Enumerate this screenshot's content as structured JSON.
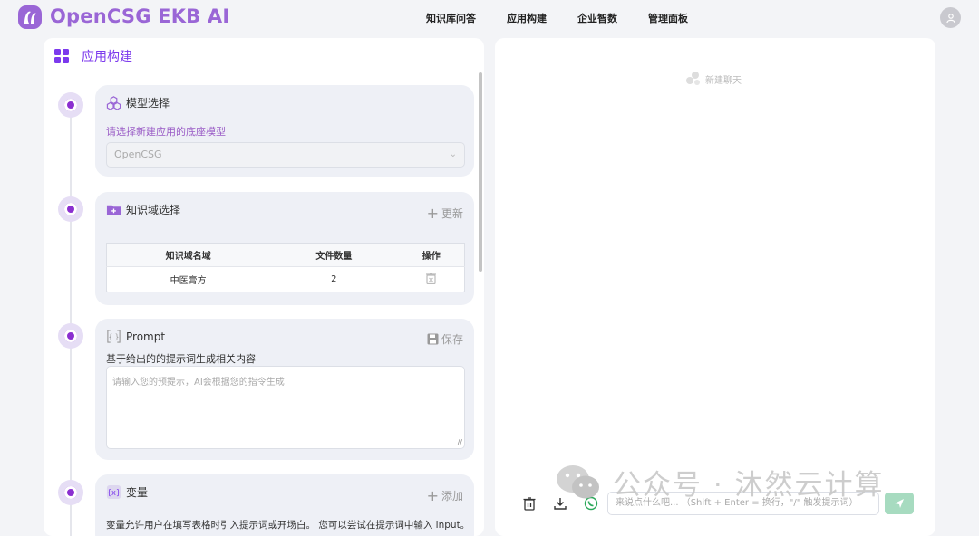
{
  "header": {
    "brand": "OpenCSG EKB AI",
    "nav": [
      "知识库问答",
      "应用构建",
      "企业智数",
      "管理面板"
    ]
  },
  "left_panel": {
    "title": "应用构建",
    "model_card": {
      "title": "模型选择",
      "description": "请选择新建应用的底座模型",
      "selected_model": "OpenCSG"
    },
    "knowledge_card": {
      "title": "知识域选择",
      "action": "更新",
      "columns": [
        "知识域名域",
        "文件数量",
        "操作"
      ],
      "rows": [
        {
          "name": "中医膏方",
          "count": "2"
        }
      ]
    },
    "prompt_card": {
      "title": "Prompt",
      "action": "保存",
      "description": "基于给出的的提示词生成相关内容",
      "placeholder": "请输入您的预提示，AI会根据您的指令生成"
    },
    "variable_card": {
      "title": "变量",
      "action": "添加",
      "description": "变量允许用户在填写表格时引入提示词或开场白。 您可以尝试在提示词中输入 input。"
    }
  },
  "right_panel": {
    "new_chat_label": "新建聊天",
    "input_placeholder": "来说点什么吧... （Shift + Enter = 换行，\"/\" 触发提示词）"
  },
  "watermark": {
    "text": "公众号 · 沐然云计算"
  },
  "colors": {
    "brand": "#9a66d6",
    "accent": "#7c3aed",
    "timeline_dot": "#8b2fd0",
    "send_button": "#a7dbc0"
  }
}
